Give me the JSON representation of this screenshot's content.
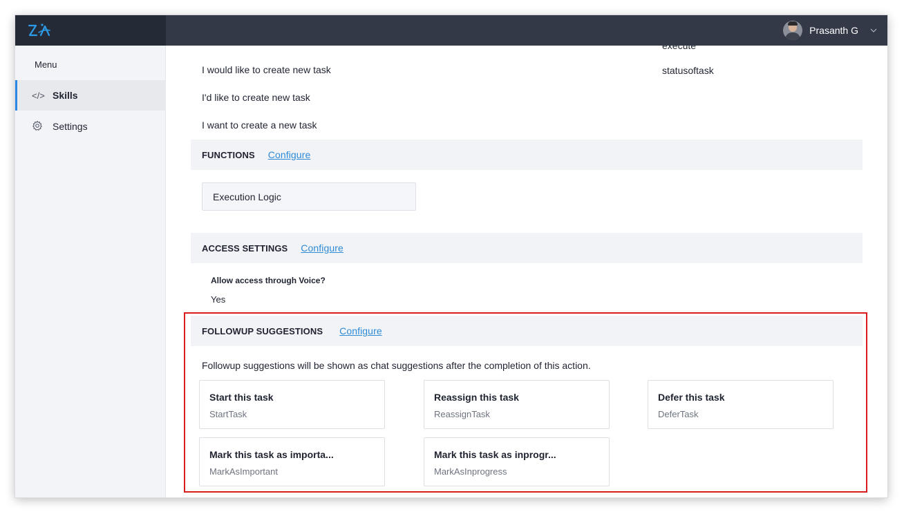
{
  "header": {
    "logo_text": "Zia",
    "user_name": "Prasanth G"
  },
  "sidebar": {
    "menu_label": "Menu",
    "items": [
      {
        "icon": "</>",
        "label": "Skills",
        "active": true
      },
      {
        "icon": "gear-icon",
        "label": "Settings",
        "active": false
      }
    ]
  },
  "main": {
    "cut_off_text": "execute",
    "right_column_text": "statusoftask",
    "utterances": [
      "I would like to create new task",
      "I'd like to create new task",
      "I want to create a new task"
    ],
    "functions": {
      "title": "FUNCTIONS",
      "configure_label": "Configure",
      "execution_logic_label": "Execution Logic"
    },
    "access_settings": {
      "title": "ACCESS SETTINGS",
      "configure_label": "Configure",
      "voice_question": "Allow access through Voice?",
      "voice_answer": "Yes"
    },
    "followup": {
      "title": "FOLLOWUP SUGGESTIONS",
      "configure_label": "Configure",
      "description": "Followup suggestions will be shown as chat suggestions after the completion of this action.",
      "cards": [
        {
          "title": "Start this task",
          "subtitle": "StartTask"
        },
        {
          "title": "Reassign this task",
          "subtitle": "ReassignTask"
        },
        {
          "title": "Defer this task",
          "subtitle": "DeferTask"
        },
        {
          "title": "Mark this task as importa...",
          "subtitle": "MarkAsImportant"
        },
        {
          "title": "Mark this task as inprogr...",
          "subtitle": "MarkAsInprogress"
        }
      ]
    }
  },
  "colors": {
    "topbar": "#343948",
    "accent": "#2c88e5",
    "link": "#2d8ad8",
    "highlight_border": "#d81c1c"
  }
}
